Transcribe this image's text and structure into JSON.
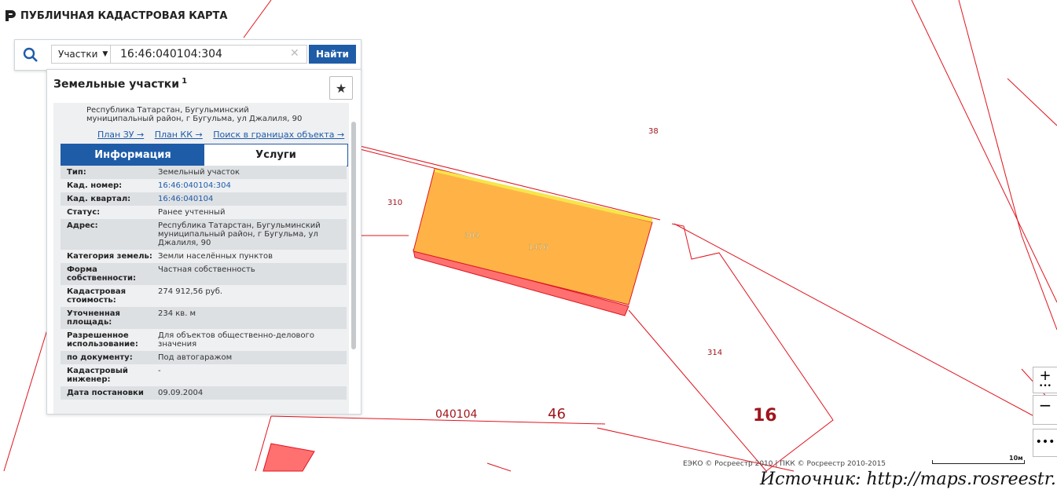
{
  "header": {
    "brand": "ПУБЛИЧНАЯ КАДАСТРОВАЯ КАРТА"
  },
  "search": {
    "type_label": "Участки",
    "query": "16:46:040104:304",
    "find_label": "Найти"
  },
  "panel": {
    "title": "Земельные участки",
    "count": "1",
    "address_line1": "Республика Татарстан, Бугульминский",
    "address_line2": "муниципальный район, г Бугульма, ул Джалиля, 90",
    "links": [
      "План ЗУ →",
      "План КК →",
      "Поиск в границах объекта →"
    ],
    "tabs": [
      "Информация",
      "Услуги"
    ],
    "rows": [
      {
        "label": "Тип:",
        "value": "Земельный участок"
      },
      {
        "label": "Кад. номер:",
        "value": "16:46:040104:304"
      },
      {
        "label": "Кад. квартал:",
        "value": "16:46:040104"
      },
      {
        "label": "Статус:",
        "value": "Ранее учтенный"
      },
      {
        "label": "Адрес:",
        "value": "Республика Татарстан, Бугульминский муниципальный район, г Бугульма, ул Джалиля, 90"
      },
      {
        "label": "Категория земель:",
        "value": "Земли населённых пунктов"
      },
      {
        "label": "Форма собственности:",
        "value": "Частная собственность"
      },
      {
        "label": "Кадастровая стоимость:",
        "value": "274 912,56 руб."
      },
      {
        "label": "Уточненная площадь:",
        "value": "234 кв. м"
      },
      {
        "label": "Разрешенное использование:",
        "value": "Для объектов общественно-делового значения"
      },
      {
        "label": "по документу:",
        "value": "Под автогаражом"
      },
      {
        "label": "Кадастровый инженер:",
        "value": "-"
      },
      {
        "label": "Дата постановки",
        "value": "09.09.2004"
      }
    ]
  },
  "map": {
    "labels": {
      "l38": "38",
      "l310": "310",
      "l304": "304",
      "l1476": "1476",
      "l314": "314",
      "l040104": "040104",
      "l46": "46",
      "l16": "16"
    },
    "colors": {
      "boundary": "#e0141e",
      "parcel_fill": "#ffb347",
      "parcel_shadow": "#ff6b6b",
      "label": "#a0151c"
    }
  },
  "controls": {
    "zoom_in": "+",
    "zoom_out": "−",
    "more": "•••"
  },
  "attribution": "ЕЭКО © Росреестр 2010 | ПКК © Росреестр 2010-2015",
  "scale_label": "10м",
  "source": "Источник: http://maps.rosreestr.ru",
  "icons": {
    "brand": "brand-icon",
    "search": "search-icon",
    "clear": "clear-icon",
    "star": "star-icon"
  }
}
